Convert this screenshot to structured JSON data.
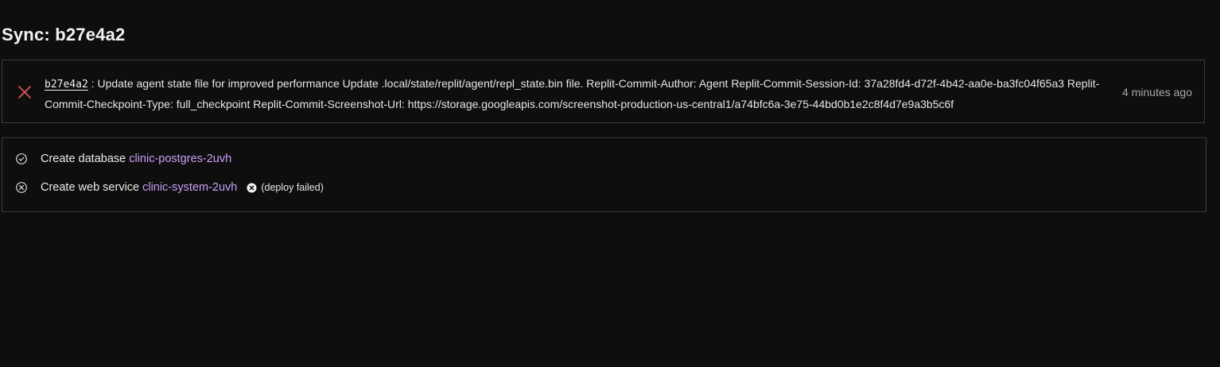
{
  "page": {
    "title": "Sync: b27e4a2"
  },
  "commit": {
    "status_icon": "close-icon",
    "hash": "b27e4a2",
    "message": " : Update agent state file for improved performance Update .local/state/replit/agent/repl_state.bin file. Replit-Commit-Author: Agent Replit-Commit-Session-Id: 37a28fd4-d72f-4b42-aa0e-ba3fc04f65a3 Replit-Commit-Checkpoint-Type: full_checkpoint Replit-Commit-Screenshot-Url: https://storage.googleapis.com/screenshot-production-us-central1/a74bfc6a-3e75-44bd0b1e2c8f4d7e9a3b5c6f",
    "time": "4 minutes ago"
  },
  "resources": [
    {
      "status": "success",
      "status_icon": "check-circle-icon",
      "action": "Create database",
      "name": "clinic-postgres-2uvh"
    },
    {
      "status": "failed",
      "status_icon": "x-circle-icon",
      "action": "Create web service",
      "name": "clinic-system-2uvh",
      "badge_icon": "x-circle-filled-icon",
      "badge": "(deploy failed)"
    }
  ],
  "colors": {
    "background": "#0f0e0e",
    "border": "#3b3b3b",
    "link": "#c7a0f5",
    "fail_icon": "#e05a5a",
    "muted": "#a7a7a7"
  }
}
